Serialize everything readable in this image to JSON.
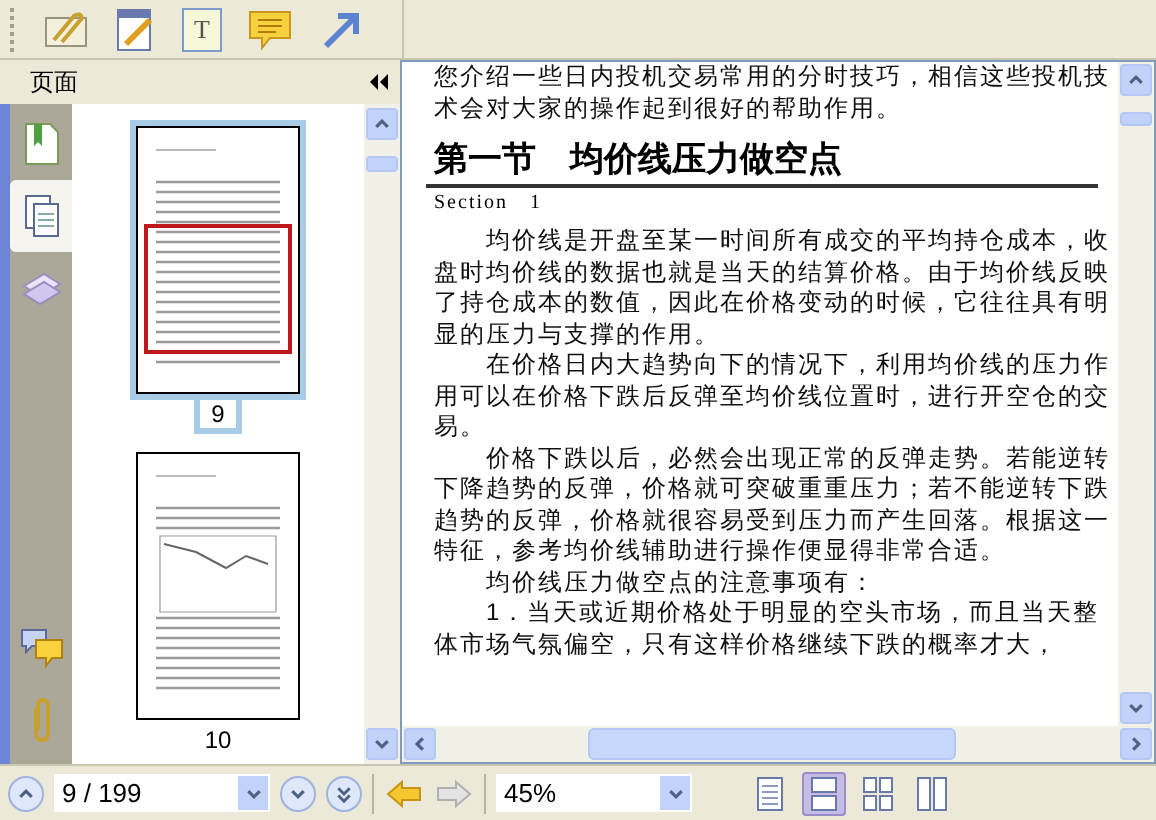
{
  "toolbar": {
    "tools": [
      {
        "kind": "attach"
      },
      {
        "kind": "note"
      },
      {
        "kind": "textbox",
        "glyph": "T"
      },
      {
        "kind": "comment"
      },
      {
        "kind": "arrow"
      }
    ]
  },
  "panel": {
    "title": "页面",
    "tabs": [
      {
        "kind": "bookmarks",
        "selected": false
      },
      {
        "kind": "pages",
        "selected": true
      },
      {
        "kind": "layers",
        "selected": false
      },
      {
        "kind": "comments",
        "selected": false
      },
      {
        "kind": "attachments",
        "selected": false
      }
    ],
    "thumbnails": [
      {
        "label": "9",
        "selected": true,
        "kind": "text"
      },
      {
        "label": "10",
        "selected": false,
        "kind": "chart"
      }
    ]
  },
  "document": {
    "blocks": [
      {
        "kind": "paragraph",
        "indent": false,
        "text": "您介绍一些日内投机交易常用的分时技巧，相信这些投机技"
      },
      {
        "kind": "paragraph",
        "indent": false,
        "text": "术会对大家的操作起到很好的帮助作用。"
      },
      {
        "kind": "heading",
        "text": "第一节　均价线压力做空点"
      },
      {
        "kind": "subheading",
        "text": "Section　1"
      },
      {
        "kind": "paragraph",
        "indent": true,
        "text": "均价线是开盘至某一时间所有成交的平均持仓成本，收盘时均价线的数据也就是当天的结算价格。由于均价线反映了持仓成本的数值，因此在价格变动的时候，它往往具有明显的压力与支撑的作用。"
      },
      {
        "kind": "paragraph",
        "indent": true,
        "text": "在价格日内大趋势向下的情况下，利用均价线的压力作用可以在价格下跌后反弹至均价线位置时，进行开空仓的交易。"
      },
      {
        "kind": "paragraph",
        "indent": true,
        "text": "价格下跌以后，必然会出现正常的反弹走势。若能逆转下降趋势的反弹，价格就可突破重重压力；若不能逆转下跌趋势的反弹，价格就很容易受到压力而产生回落。根据这一特征，参考均价线辅助进行操作便显得非常合适。"
      },
      {
        "kind": "paragraph",
        "indent": true,
        "text": "均价线压力做空点的注意事项有："
      },
      {
        "kind": "paragraph",
        "indent": true,
        "text": "1．当天或近期价格处于明显的空头市场，而且当天整体市场气氛偏空，只有这样价格继续下跌的概率才大，"
      }
    ]
  },
  "navigation": {
    "page": "9 / 199",
    "back_enabled": true,
    "forward_enabled": false,
    "zoom": "45%",
    "view_modes": [
      {
        "kind": "single",
        "selected": false
      },
      {
        "kind": "continuous",
        "selected": true
      },
      {
        "kind": "facing",
        "selected": false
      },
      {
        "kind": "columns",
        "selected": false
      }
    ]
  }
}
